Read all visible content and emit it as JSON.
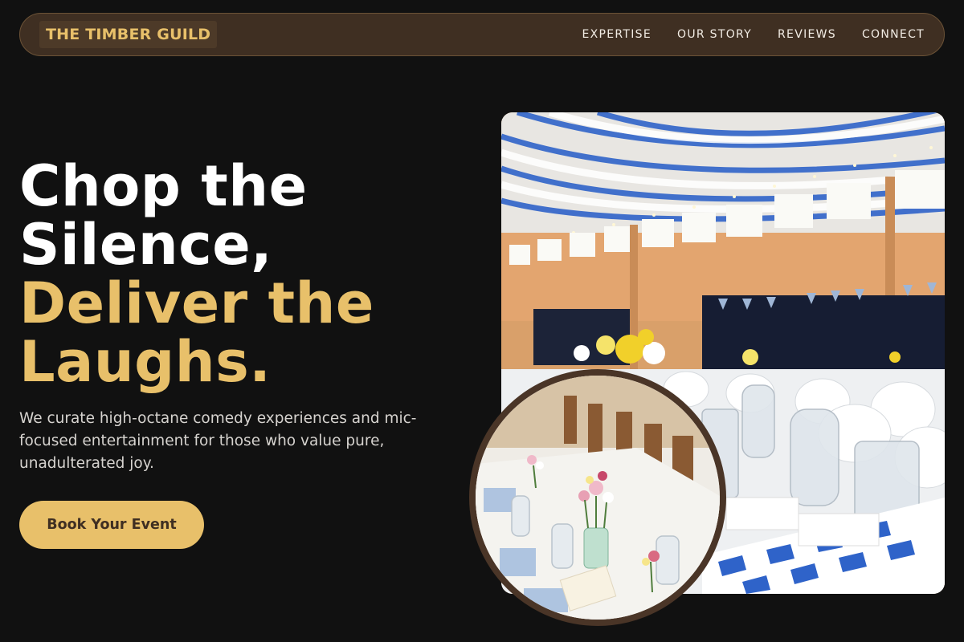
{
  "nav": {
    "logo": "THE TIMBER GUILD",
    "links": [
      "EXPERTISE",
      "OUR STORY",
      "REVIEWS",
      "CONNECT"
    ]
  },
  "hero": {
    "title_line1": "Chop the",
    "title_line2": "Silence,",
    "title_line3": "Deliver the",
    "title_line4": "Laughs.",
    "subtitle": "We curate high-octane comedy experiences and mic-focused entertainment for those who value pure, unadulterated joy.",
    "cta_label": "Book Your Event"
  },
  "images": {
    "main_photo": "banquet-hall-photo",
    "inset_photo": "table-setting-photo"
  },
  "colors": {
    "background": "#111111",
    "nav_bg": "#3f2f22",
    "accent_gold": "#e8c06a",
    "brown": "#4a3527"
  }
}
